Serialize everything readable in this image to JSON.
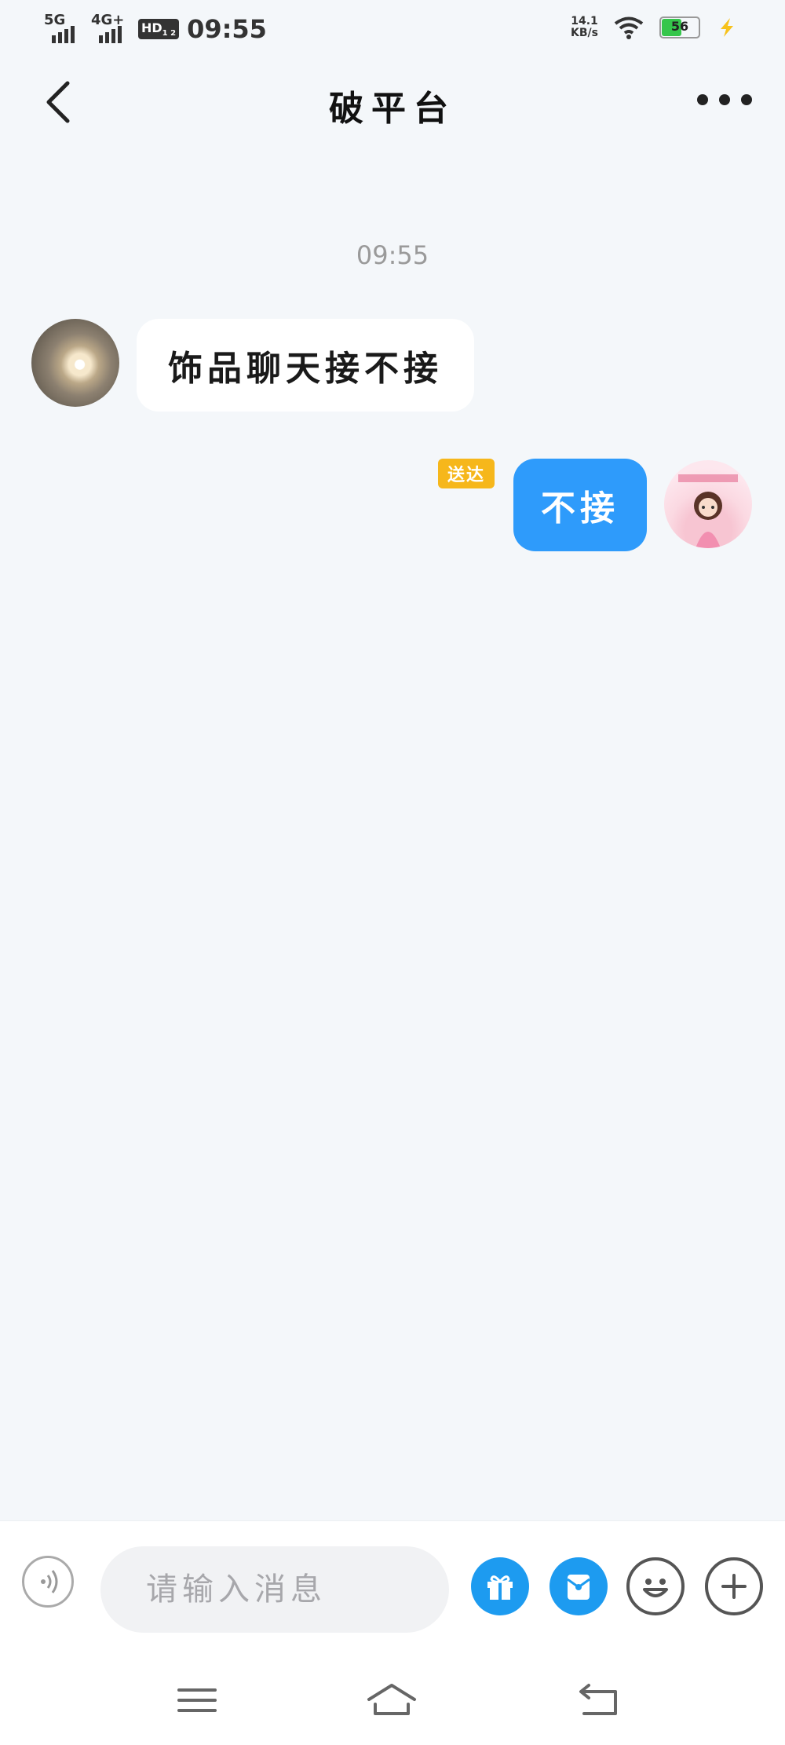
{
  "status_bar": {
    "network_1": "5G",
    "network_2": "4G+",
    "hd_label": "HD",
    "hd_sub": "1 2",
    "time": "09:55",
    "speed_value": "14.1",
    "speed_unit": "KB/s",
    "battery": "56",
    "battery_level_percent": 56
  },
  "header": {
    "title": "破平台",
    "back_icon": "chevron-left-icon",
    "more_icon": "more-dots-icon"
  },
  "chat": {
    "time_label": "09:55",
    "messages": [
      {
        "from": "other",
        "text": "饰品聊天接不接"
      },
      {
        "from": "self",
        "text": "不接",
        "status": "送达"
      }
    ]
  },
  "input_bar": {
    "placeholder": "请输入消息",
    "icons": [
      "voice-icon",
      "gift-icon",
      "red-packet-icon",
      "emoji-icon",
      "plus-icon"
    ],
    "accent_color": "#1d9bf0"
  },
  "nav_bar": {
    "icons": [
      "menu-icon",
      "home-icon",
      "back-icon"
    ]
  },
  "colors": {
    "background": "#f4f7fa",
    "self_bubble": "#2e9bfb",
    "status_badge": "#f6b71b"
  }
}
